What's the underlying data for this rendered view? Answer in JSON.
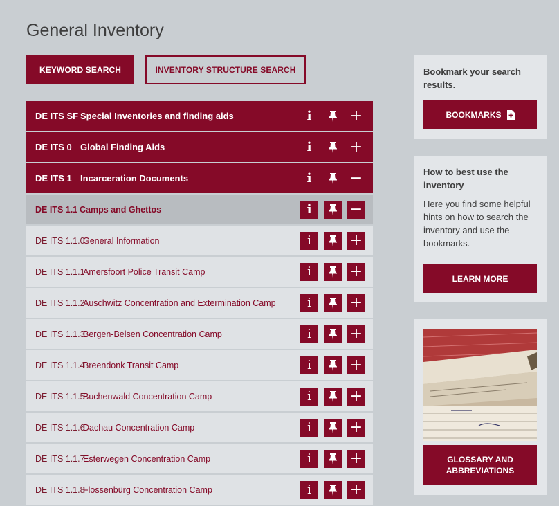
{
  "page": {
    "title": "General Inventory"
  },
  "tabs": {
    "keyword": "KEYWORD SEARCH",
    "structure": "INVENTORY STRUCTURE SEARCH"
  },
  "inventory": {
    "rows": [
      {
        "code": "DE ITS SF",
        "label": "Special Inventories and finding aids",
        "level": "top",
        "expanded": false
      },
      {
        "code": "DE ITS 0",
        "label": "Global Finding Aids",
        "level": "top",
        "expanded": false
      },
      {
        "code": "DE ITS 1",
        "label": "Incarceration Documents",
        "level": "top",
        "expanded": true
      },
      {
        "code": "DE ITS 1.1",
        "label": "Camps and Ghettos",
        "level": "sub",
        "expanded": true
      },
      {
        "code": "DE ITS 1.1.0",
        "label": "General Information",
        "level": "leaf",
        "expanded": false
      },
      {
        "code": "DE ITS 1.1.1",
        "label": "Amersfoort Police Transit Camp",
        "level": "leaf",
        "expanded": false
      },
      {
        "code": "DE ITS 1.1.2",
        "label": "Auschwitz Concentration and Extermination Camp",
        "level": "leaf",
        "expanded": false
      },
      {
        "code": "DE ITS 1.1.3",
        "label": "Bergen-Belsen Concentration Camp",
        "level": "leaf",
        "expanded": false
      },
      {
        "code": "DE ITS 1.1.4",
        "label": "Breendonk Transit Camp",
        "level": "leaf",
        "expanded": false
      },
      {
        "code": "DE ITS 1.1.5",
        "label": "Buchenwald Concentration Camp",
        "level": "leaf",
        "expanded": false
      },
      {
        "code": "DE ITS 1.1.6",
        "label": "Dachau Concentration Camp",
        "level": "leaf",
        "expanded": false
      },
      {
        "code": "DE ITS 1.1.7",
        "label": "Esterwegen Concentration Camp",
        "level": "leaf",
        "expanded": false
      },
      {
        "code": "DE ITS 1.1.8",
        "label": "Flossenbürg Concentration Camp",
        "level": "leaf",
        "expanded": false
      }
    ],
    "icons": {
      "info": "i",
      "expand": "+",
      "collapse": "−"
    }
  },
  "sidebar": {
    "bookmark": {
      "text": "Bookmark your search results.",
      "button": "BOOKMARKS"
    },
    "howto": {
      "heading": "How to best use the inventory",
      "text": "Here you find some helpful hints on how to search the inventory and use the bookmarks.",
      "button": "LEARN MORE"
    },
    "glossary": {
      "button": "GLOSSARY AND ABBREVIATIONS"
    }
  },
  "colors": {
    "accent": "#850a28",
    "background": "#c9ced2",
    "panel": "#e3e6e9"
  }
}
